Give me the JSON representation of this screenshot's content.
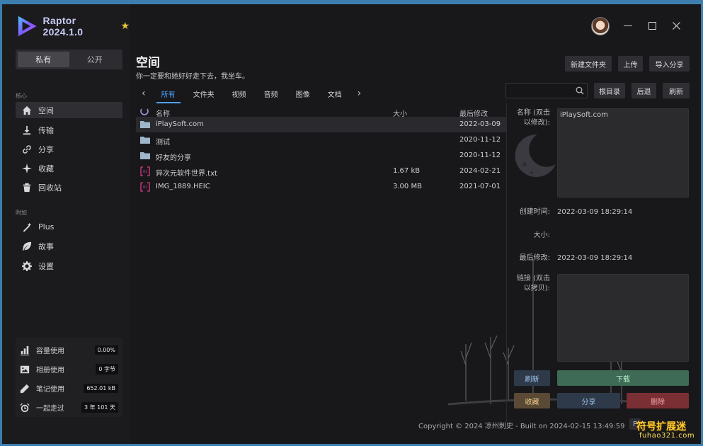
{
  "app": {
    "title": "Raptor 2024.1.0"
  },
  "sidebar": {
    "toggle": {
      "private_label": "私有",
      "public_label": "公开"
    },
    "core_label": "核心",
    "core_items": [
      {
        "label": "空间",
        "icon": "home-icon"
      },
      {
        "label": "传输",
        "icon": "download-icon"
      },
      {
        "label": "分享",
        "icon": "link-icon"
      },
      {
        "label": "收藏",
        "icon": "sparkle-icon"
      },
      {
        "label": "回收站",
        "icon": "trash-icon"
      }
    ],
    "extra_label": "附加",
    "extra_items": [
      {
        "label": "Plus",
        "icon": "magic-wand-icon"
      },
      {
        "label": "故事",
        "icon": "leaf-icon"
      },
      {
        "label": "设置",
        "icon": "gear-icon"
      }
    ],
    "stats": [
      {
        "label": "容量使用",
        "value": "0.00%",
        "icon": "bar-chart-icon"
      },
      {
        "label": "相册使用",
        "value": "0 字节",
        "icon": "image-icon"
      },
      {
        "label": "笔记使用",
        "value": "652.01 kB",
        "icon": "pen-icon"
      },
      {
        "label": "一起走过",
        "value": "3 年 101 天",
        "icon": "alarm-clock-icon"
      }
    ]
  },
  "header": {
    "title": "空间",
    "subtitle": "你一定要和她好好走下去，我坐车。",
    "buttons": {
      "new_folder": "新建文件夹",
      "upload": "上传",
      "import_share": "导入分享"
    },
    "tabs": [
      "所有",
      "文件夹",
      "视频",
      "音频",
      "图像",
      "文档"
    ],
    "active_tab": 0,
    "search": {
      "value": "",
      "placeholder": ""
    },
    "nav_buttons": {
      "root": "根目录",
      "back": "后退",
      "refresh": "刷新"
    }
  },
  "file_list": {
    "columns": {
      "name": "名称",
      "size": "大小",
      "modified": "最后修改"
    },
    "rows": [
      {
        "name": "iPlaySoft.com",
        "size": "",
        "modified": "2022-03-09",
        "type": "folder",
        "selected": true
      },
      {
        "name": "测试",
        "size": "",
        "modified": "2020-11-12",
        "type": "folder",
        "selected": false
      },
      {
        "name": "好友的分享",
        "size": "",
        "modified": "2020-11-12",
        "type": "folder",
        "selected": false
      },
      {
        "name": "异次元软件世界.txt",
        "size": "1.67 kB",
        "modified": "2024-02-21",
        "type": "file",
        "selected": false
      },
      {
        "name": "IMG_1889.HEIC",
        "size": "3.00 MB",
        "modified": "2021-07-01",
        "type": "file",
        "selected": false
      }
    ]
  },
  "details": {
    "name_label": "名称 (双击以修改):",
    "name_value": "iPlaySoft.com",
    "created_label": "创建时间:",
    "created_value": "2022-03-09 18:29:14",
    "size_label": "大小:",
    "size_value": "",
    "modified_label": "最后修改:",
    "modified_value": "2022-03-09 18:29:14",
    "link_label": "链接 (双击以拷贝):",
    "link_value": "",
    "buttons": {
      "refresh": "刷新",
      "download": "下载",
      "favorite": "收藏",
      "share": "分享",
      "delete": "删除"
    }
  },
  "footer": {
    "copyright": "Copyright © 2024 凉州刺史 - Built on 2024-02-15 13:49:59",
    "badge": "P"
  },
  "watermark": {
    "line1": "符号扩展迷",
    "line2": "fuhao321.com"
  },
  "colors": {
    "accent": "#4ea3ff",
    "download_green": "#3e6b55",
    "delete_red": "#7a2f35",
    "favorite_brown": "#5a4a35"
  }
}
